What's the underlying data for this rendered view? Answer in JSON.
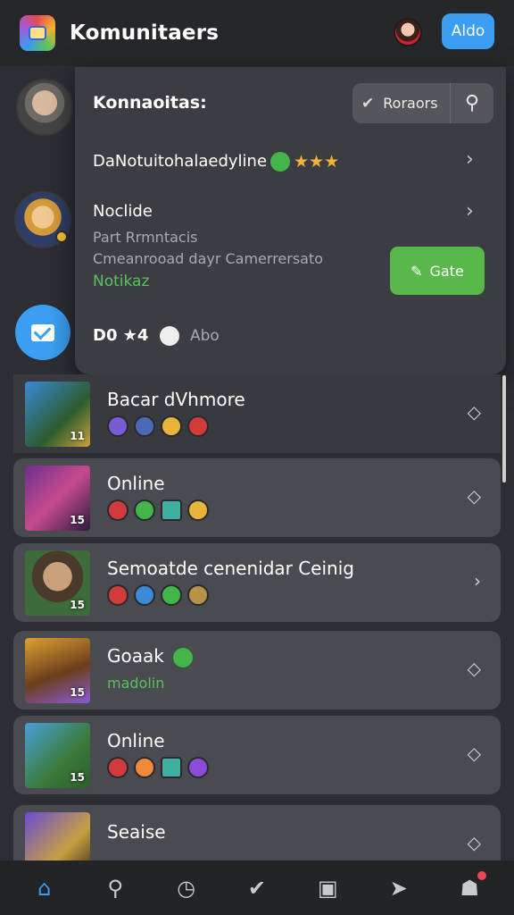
{
  "header": {
    "app_title": "Komunitaers",
    "action_button": "Aldo",
    "colors": {
      "accent": "#3a9ff2",
      "background": "#2d2e33"
    }
  },
  "popup": {
    "title": "Konnaoitas:",
    "filter_label": "Roraors",
    "rows": [
      {
        "text": "DaNotuitohalaedyline",
        "rating_stars": "★★★"
      },
      {
        "title": "Noclide",
        "line1": "Part Rrmntacis",
        "line2": "Cmeanrooad dayr Camerrersato",
        "status": "Notikaz"
      },
      {
        "text": "D0 ★4",
        "suffix": "Abo"
      }
    ],
    "save_button": "Gate"
  },
  "list": [
    {
      "title": "Bacar dVhmore",
      "badge": "11"
    },
    {
      "title": "Online",
      "badge": "15"
    },
    {
      "title": "Semoatde cenenidar Ceinig",
      "badge": "15"
    },
    {
      "title": "Goaak",
      "subtitle": "madolin",
      "badge": "15"
    },
    {
      "title": "Online",
      "badge": "15"
    },
    {
      "title": "Seaise"
    }
  ],
  "nav": [
    "home-icon",
    "search-icon",
    "activity-icon",
    "check-icon",
    "calendar-icon",
    "send-icon",
    "profile-icon"
  ]
}
